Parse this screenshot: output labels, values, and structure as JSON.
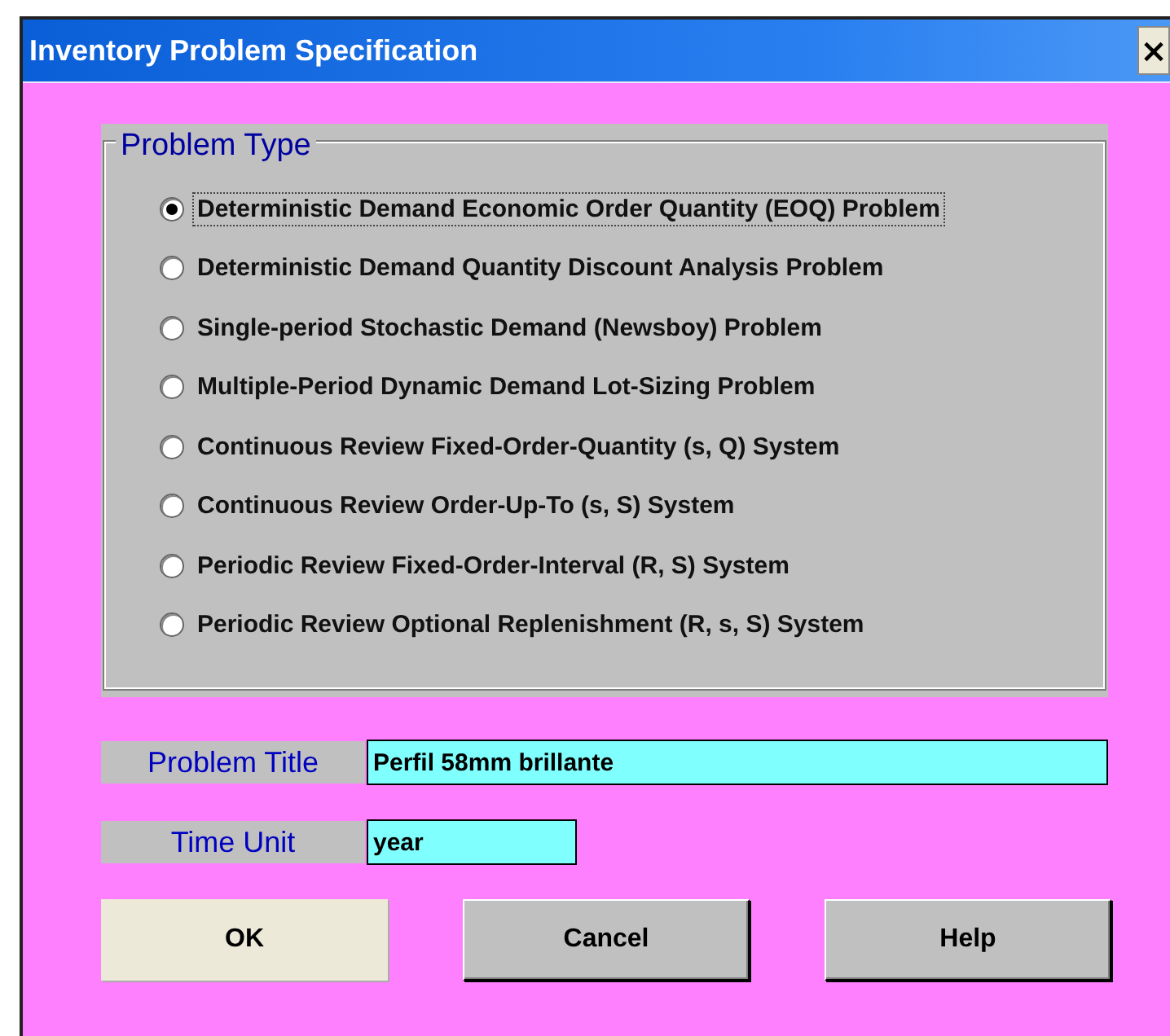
{
  "window": {
    "title": "Inventory Problem Specification",
    "close_button": "×"
  },
  "problem_type": {
    "legend": "Problem Type",
    "options": [
      {
        "label": "Deterministic Demand Economic Order Quantity (EOQ) Problem",
        "selected": true
      },
      {
        "label": "Deterministic Demand Quantity Discount Analysis Problem",
        "selected": false
      },
      {
        "label": "Single-period Stochastic Demand (Newsboy) Problem",
        "selected": false
      },
      {
        "label": "Multiple-Period Dynamic Demand Lot-Sizing Problem",
        "selected": false
      },
      {
        "label": "Continuous Review Fixed-Order-Quantity (s, Q) System",
        "selected": false
      },
      {
        "label": "Continuous Review Order-Up-To (s, S) System",
        "selected": false
      },
      {
        "label": "Periodic Review Fixed-Order-Interval (R, S) System",
        "selected": false
      },
      {
        "label": "Periodic Review Optional Replenishment (R, s, S) System",
        "selected": false
      }
    ]
  },
  "fields": [
    {
      "label": "Problem Title",
      "value": "Perfil 58mm brillante",
      "kind": "wide"
    },
    {
      "label": "Time Unit",
      "value": "year",
      "kind": "short"
    }
  ],
  "buttons": [
    {
      "label": "OK",
      "focused": true
    },
    {
      "label": "Cancel",
      "focused": false
    },
    {
      "label": "Help",
      "focused": false
    }
  ]
}
